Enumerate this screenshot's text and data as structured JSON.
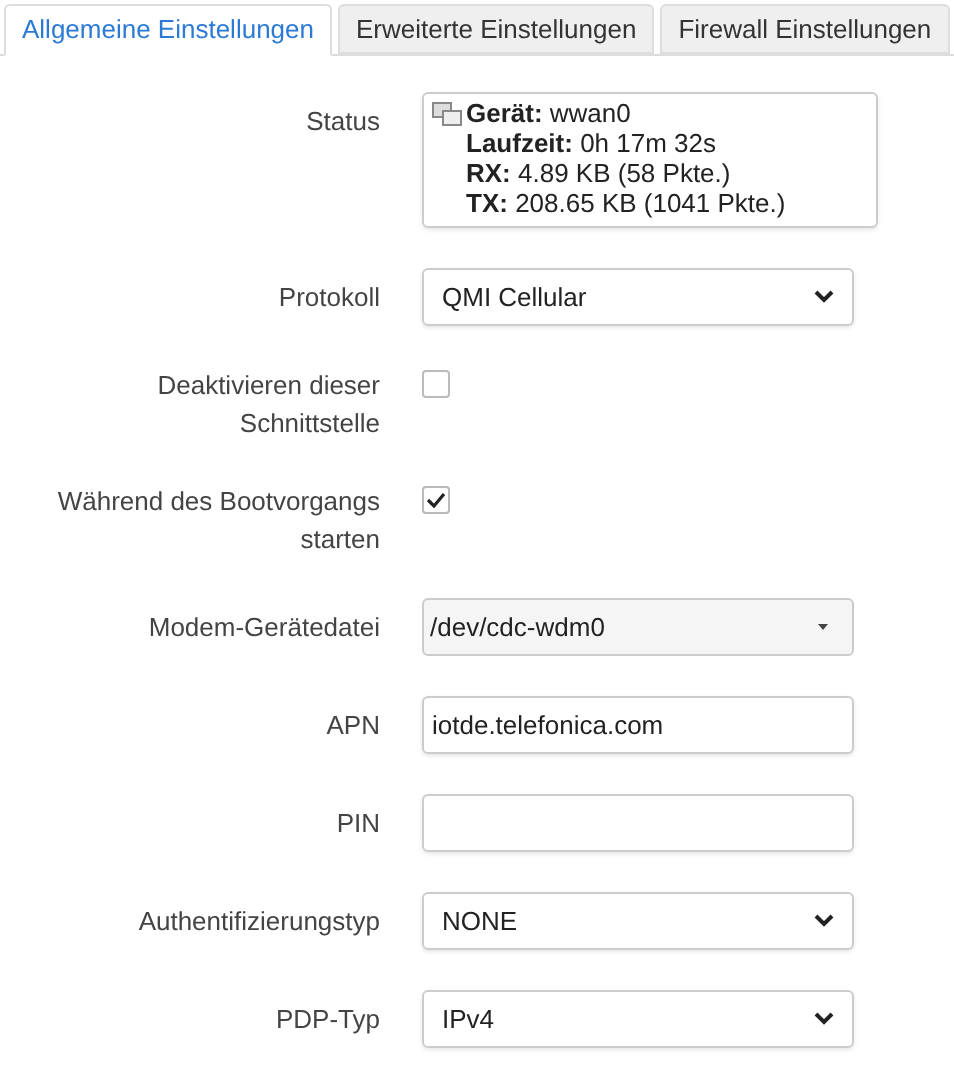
{
  "tabs": [
    {
      "label": "Allgemeine Einstellungen",
      "selected": true
    },
    {
      "label": "Erweiterte Einstellungen",
      "selected": false
    },
    {
      "label": "Firewall Einstellungen",
      "selected": false
    }
  ],
  "fields": [
    {
      "kind": "status",
      "label": "Status",
      "lines": [
        "**Gerät:** wwan0",
        "**Laufzeit:** 0h 17m 32s",
        "**RX:** 4.89 KB (58 Pkte.)",
        "**TX:** 208.65 KB (1041 Pkte.)"
      ]
    },
    {
      "kind": "select",
      "label": "Protokoll",
      "value": "QMI Cellular"
    },
    {
      "kind": "checkbox",
      "label": "Deaktivieren dieser Schnittstelle",
      "checked": false
    },
    {
      "kind": "checkbox",
      "label": "Während des Bootvorgangs starten",
      "checked": true
    },
    {
      "kind": "combo",
      "label": "Modem-Gerätedatei",
      "value": "/dev/cdc-wdm0"
    },
    {
      "kind": "text",
      "label": "APN",
      "value": "iotde.telefonica.com"
    },
    {
      "kind": "text",
      "label": "PIN"
    },
    {
      "kind": "select",
      "label": "Authentifizierungstyp",
      "value": "NONE"
    },
    {
      "kind": "select",
      "label": "PDP-Typ",
      "value": "IPv4"
    }
  ]
}
